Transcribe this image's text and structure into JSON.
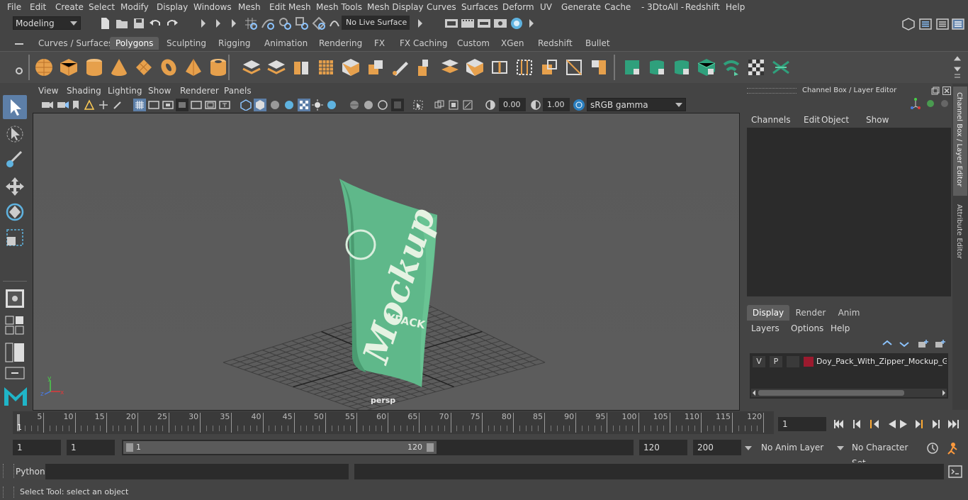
{
  "menus": [
    "File",
    "Edit",
    "Create",
    "Select",
    "Modify",
    "Display",
    "Windows",
    "Mesh",
    "Edit Mesh",
    "Mesh Tools",
    "Mesh Display",
    "Curves",
    "Surfaces",
    "Deform",
    "UV",
    "Generate",
    "Cache",
    "- 3DtoAll -",
    "Redshift",
    "Help"
  ],
  "status": {
    "mode": "Modeling",
    "live_surface": "No Live Surface"
  },
  "shelf_tabs": [
    "Curves / Surfaces",
    "Polygons",
    "Sculpting",
    "Rigging",
    "Animation",
    "Rendering",
    "FX",
    "FX Caching",
    "Custom",
    "XGen",
    "Redshift",
    "Bullet"
  ],
  "shelf_active": "Polygons",
  "viewport": {
    "menus": [
      "View",
      "Shading",
      "Lighting",
      "Show",
      "Renderer",
      "Panels"
    ],
    "exposure": "0.00",
    "gamma": "1.00",
    "color_space": "sRGB gamma",
    "camera_label": "persp",
    "pack_text_1": "Mockup",
    "pack_text_2": "YPACK"
  },
  "channel_box": {
    "title": "Channel Box / Layer Editor",
    "menus": [
      "Channels",
      "Edit",
      "Object",
      "Show"
    ],
    "layer_tabs": [
      "Display",
      "Render",
      "Anim"
    ],
    "layer_active": "Display",
    "layer_menus": [
      "Layers",
      "Options",
      "Help"
    ],
    "layer": {
      "v": "V",
      "p": "P",
      "name": "Doy_Pack_With_Zipper_Mockup_Green",
      "color": "#9b1a2e"
    }
  },
  "side_tabs": [
    "Channel Box / Layer Editor",
    "Attribute Editor"
  ],
  "timeline": {
    "ticks": [
      "5",
      "10",
      "15",
      "20",
      "25",
      "30",
      "35",
      "40",
      "45",
      "50",
      "55",
      "60",
      "65",
      "70",
      "75",
      "80",
      "85",
      "90",
      "95",
      "100",
      "105",
      "110",
      "115",
      "120"
    ],
    "start_tick": "1",
    "current_frame": "1"
  },
  "range": {
    "start": "1",
    "playback_start": "1",
    "slider_start": "1",
    "slider_end": "120",
    "playback_end": "120",
    "end": "200",
    "anim_layer": "No Anim Layer",
    "character_set": "No Character Set"
  },
  "command": {
    "language": "Python"
  },
  "help_line": "Select Tool: select an object",
  "colors": {
    "accent_blue": "#5c91c7",
    "pack_green": "#5fb88a",
    "shelf_orange": "#e6a04c",
    "shelf_teal": "#2fa07c"
  }
}
